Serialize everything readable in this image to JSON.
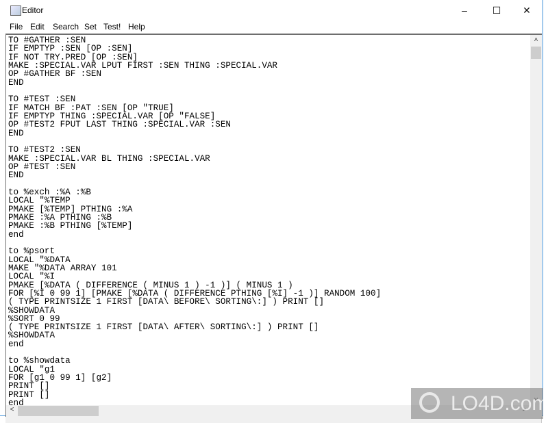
{
  "window": {
    "title": "Editor",
    "controls": {
      "minimize": "–",
      "maximize": "☐",
      "close": "✕"
    }
  },
  "menu": [
    "File",
    "Edit",
    "Search",
    "Set",
    "Test!",
    "Help"
  ],
  "editor": {
    "lines": [
      "TO #GATHER :SEN",
      "IF EMPTYP :SEN [OP :SEN]",
      "IF NOT TRY.PRED [OP :SEN]",
      "MAKE :SPECIAL.VAR LPUT FIRST :SEN THING :SPECIAL.VAR",
      "OP #GATHER BF :SEN",
      "END",
      "",
      "TO #TEST :SEN",
      "IF MATCH BF :PAT :SEN [OP \"TRUE]",
      "IF EMPTYP THING :SPECIAL.VAR [OP \"FALSE]",
      "OP #TEST2 FPUT LAST THING :SPECIAL.VAR :SEN",
      "END",
      "",
      "TO #TEST2 :SEN",
      "MAKE :SPECIAL.VAR BL THING :SPECIAL.VAR",
      "OP #TEST :SEN",
      "END",
      "",
      "to %exch :%A :%B",
      "LOCAL \"%TEMP",
      "PMAKE [%TEMP] PTHING :%A",
      "PMAKE :%A PTHING :%B",
      "PMAKE :%B PTHING [%TEMP]",
      "end",
      "",
      "to %psort",
      "LOCAL \"%DATA",
      "MAKE \"%DATA ARRAY 101",
      "LOCAL \"%I",
      "PMAKE [%DATA ( DIFFERENCE ( MINUS 1 ) -1 )] ( MINUS 1 )",
      "FOR [%I 0 99 1] [PMAKE [%DATA ( DIFFERENCE PTHING [%I] -1 )] RANDOM 100]",
      "( TYPE PRINTSIZE 1 FIRST [DATA\\ BEFORE\\ SORTING\\:] ) PRINT []",
      "%SHOWDATA",
      "%SORT 0 99",
      "( TYPE PRINTSIZE 1 FIRST [DATA\\ AFTER\\ SORTING\\:] ) PRINT []",
      "%SHOWDATA",
      "end",
      "",
      "to %showdata",
      "LOCAL \"g1",
      "FOR [g1 0 99 1] [g2]",
      "PRINT []",
      "PRINT []",
      "end"
    ]
  },
  "scrollbars": {
    "up": "˄",
    "down": "˅",
    "left": "<",
    "right": ">"
  },
  "watermark": "LO4D.com"
}
